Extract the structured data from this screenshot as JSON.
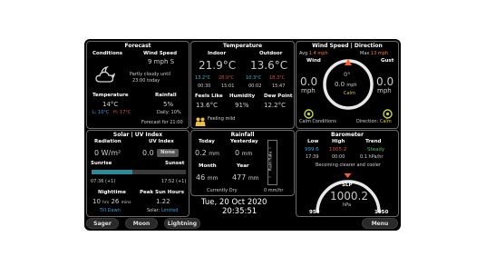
{
  "forecast": {
    "title": "Forecast",
    "conditions_label": "Conditions",
    "windspeed_label": "Wind Speed",
    "windspeed_value": "9 mph S",
    "summary_line1": "Partly cloudy until",
    "summary_line2": "23:00 today",
    "temperature_label": "Temperature",
    "temperature_value": "14°C",
    "low_label": "L: 10°C",
    "high_label": "H: 17°C",
    "rainfall_label": "Rainfall",
    "rainfall_value": "5%",
    "rainfall_daily": "Daily: 10%",
    "footer": "Forecast for 21:00"
  },
  "temperature": {
    "title": "Temperature",
    "indoor_label": "Indoor",
    "outdoor_label": "Outdoor",
    "indoor_value": "21.9°C",
    "outdoor_value": "13.6°C",
    "indoor_low": "13.2°C",
    "indoor_high": "28.0°C",
    "outdoor_low": "10.3°C",
    "outdoor_high": "18.3°C",
    "indoor_low_time": "00:30",
    "indoor_high_time": "15:01",
    "outdoor_low_time": "00:02",
    "outdoor_high_time": "15:47",
    "feels_label": "Feels Like",
    "feels_value": "13.6°C",
    "humidity_label": "Humidity",
    "humidity_value": "91%",
    "dew_label": "Dew Point",
    "dew_value": "12.2°C",
    "feeling": "Feeling mild"
  },
  "wind": {
    "title": "Wind Speed | Direction",
    "avg_label": "Avg",
    "avg_value": "1.4 mph",
    "wind_label": "Wind",
    "max_label": "Max",
    "max_value": "13 mph",
    "gust_label": "Gust",
    "left_value": "0.0",
    "left_unit": "mph",
    "right_value": "0.0",
    "right_unit": "mph",
    "dial_direction": "0°",
    "dial_speed": "0.0",
    "dial_unit": "mph",
    "dial_state": "Calm",
    "calm_conditions": "Calm Conditions",
    "direction_label": "Direction:",
    "direction_value": "Calm"
  },
  "solar": {
    "title": "Solar | UV Index",
    "radiation_label": "Radiation",
    "radiation_value": "0 W/m²",
    "uv_label": "UV Index",
    "uv_value": "0.0",
    "uv_badge": "None",
    "sunrise_label": "Sunrise",
    "sunset_label": "Sunset",
    "sunrise_time": "07:36 (+1)",
    "sunset_time": "17:52 (+1)",
    "nighttime_label": "Nighttime",
    "nighttime_hours": "10",
    "nighttime_hrs_unit": "hrs",
    "nighttime_mins": "26",
    "nighttime_mins_unit": "mins",
    "till_dawn": "Till Dawn",
    "peak_label": "Peak Sun Hours",
    "peak_value": "1.22",
    "solar_label": "Solar:",
    "solar_value": "Limited",
    "day_fraction": 0.43
  },
  "rainfall": {
    "title": "Rainfall",
    "today_label": "Today",
    "yesterday_label": "Yesterday",
    "today_value": "0.2",
    "today_unit": "mm",
    "yesterday_value": "0",
    "yesterday_unit": "mm",
    "month_label": "Month",
    "year_label": "Year",
    "month_value": "46",
    "month_unit": "mm",
    "year_value": "477",
    "year_unit": "mm",
    "rain_rate_label": "Rain Rate",
    "status": "Currently Dry",
    "rate_value": "0 mm/hr"
  },
  "datetime": {
    "date": "Tue, 20 Oct 2020",
    "time": "20:35:51"
  },
  "barometer": {
    "title": "Barometer",
    "low_label": "Low",
    "high_label": "High",
    "trend_label": "Trend",
    "low_value": "999.6",
    "high_value": "1005.2",
    "trend_value": "Steady",
    "low_time": "17:39",
    "high_time": "00:00",
    "trend_rate": "0.1 hPa/hr",
    "forecast_text": "Becoming clearer and cooler",
    "slp_label": "SLP",
    "slp_value": "1000.2",
    "slp_unit": "hPa",
    "scale_min": "950",
    "scale_max": "1050"
  },
  "nav": {
    "sager": "Sager",
    "moon": "Moon",
    "lightning": "Lightning",
    "menu": "Menu"
  },
  "colors": {
    "accent_blue": "#3aa0e0",
    "accent_red": "#e04a3a",
    "accent_green": "#4fc05a",
    "accent_orange": "#ff7a2a"
  }
}
